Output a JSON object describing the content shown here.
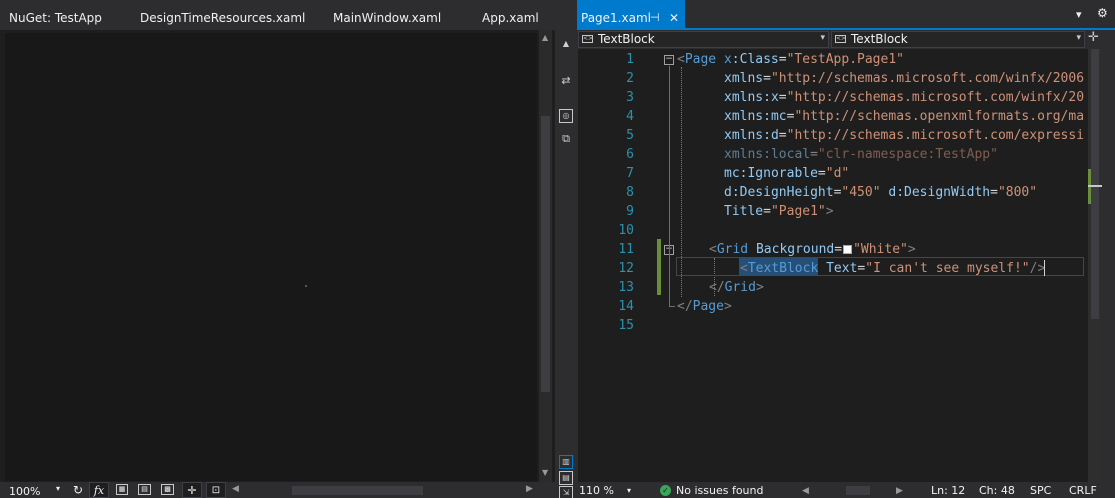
{
  "tabs": {
    "nuget": "NuGet: TestApp",
    "design_time": "DesignTimeResources.xaml",
    "main_window": "MainWindow.xaml",
    "app": "App.xaml",
    "page1": "Page1.xaml",
    "pin_icon": "⊣",
    "close_icon": "✕",
    "overflow_icon": "▾"
  },
  "designer": {
    "zoom": "100%",
    "fx_label": "fx"
  },
  "combos": {
    "left": "TextBlock",
    "right": "TextBlock"
  },
  "editor": {
    "line_numbers": [
      "1",
      "2",
      "3",
      "4",
      "5",
      "6",
      "7",
      "8",
      "9",
      "10",
      "11",
      "12",
      "13",
      "14",
      "15"
    ],
    "lines": {
      "l1_open": "<",
      "l1_page": "Page",
      "l1_attr_ns": "x",
      "l1_attr": ":Class",
      "l1_eq": "=",
      "l1_val": "\"TestApp.Page1\"",
      "l2_attr": "xmlns",
      "l2_val": "\"http://schemas.microsoft.com/winfx/2006",
      "l3_attr": "xmlns:x",
      "l3_val": "\"http://schemas.microsoft.com/winfx/20",
      "l4_attr": "xmlns:mc",
      "l4_val": "\"http://schemas.openxmlformats.org/ma",
      "l5_attr": "xmlns:d",
      "l5_val": "\"http://schemas.microsoft.com/expressi",
      "l6_attr": "xmlns:local",
      "l6_val": "\"clr-namespace:TestApp\"",
      "l7_attr": "mc:Ignorable",
      "l7_val": "\"d\"",
      "l8_attr1": "d:DesignHeight",
      "l8_val1": "\"450\"",
      "l8_attr2": "d:DesignWidth",
      "l8_val2": "\"800\"",
      "l9_attr": "Title",
      "l9_val": "\"Page1\"",
      "l9_close": ">",
      "l11_open": "<",
      "l11_el": "Grid",
      "l11_attr": "Background",
      "l11_val": "\"White\"",
      "l11_close": ">",
      "l12_open": "<",
      "l12_el": "TextBlock",
      "l12_attr": "Text",
      "l12_val": "\"I can't see myself!\"",
      "l12_close": "/>",
      "l13_open": "</",
      "l13_el": "Grid",
      "l13_close": ">",
      "l14_open": "</",
      "l14_el": "Page",
      "l14_close": ">"
    }
  },
  "status": {
    "zoom": "110 %",
    "issues": "No issues found",
    "ln": "Ln: 12",
    "ch": "Ch: 48",
    "spc": "SPC",
    "crlf": "CRLF"
  },
  "colors": {
    "accent": "#007acc",
    "background": "#1e1e1e",
    "line_number": "#2b91af",
    "element": "#569cd6",
    "attribute": "#92caf4",
    "string": "#ce9178",
    "change_marker": "#6a8f3a"
  }
}
